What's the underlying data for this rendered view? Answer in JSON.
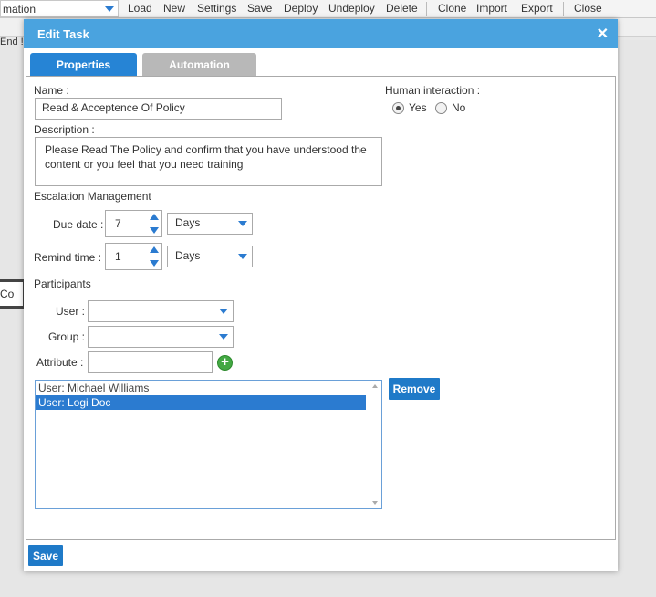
{
  "background": {
    "workflow_select": "mation",
    "menu": [
      "Load",
      "New",
      "Settings",
      "Save",
      "Deploy",
      "Undeploy",
      "Delete",
      "Clone",
      "Import",
      "Export",
      "Close"
    ],
    "end_label": "End !",
    "node_label": "Co"
  },
  "dialog": {
    "title": "Edit Task",
    "close_glyph": "✕",
    "tabs": {
      "properties": "Properties",
      "automation": "Automation"
    },
    "name_label": "Name :",
    "name_value": "Read & Acceptence Of Policy",
    "description_label": "Description :",
    "description_value": "Please Read The Policy and confirm that you have understood the content or you feel that you need training",
    "human_interaction_label": "Human interaction :",
    "human_interaction": {
      "yes": "Yes",
      "no": "No",
      "selected": "Yes"
    },
    "escalation_label": "Escalation Management",
    "due_date": {
      "label": "Due date :",
      "value": "7",
      "unit": "Days"
    },
    "remind_time": {
      "label": "Remind time :",
      "value": "1",
      "unit": "Days"
    },
    "participants_label": "Participants",
    "user_label": "User :",
    "group_label": "Group :",
    "attribute_label": "Attribute :",
    "add_glyph": "+",
    "participants_list": [
      "User: Michael Williams",
      "User: Logi Doc"
    ],
    "selected_participant": "User: Logi Doc",
    "remove_button": "Remove",
    "save_button": "Save"
  },
  "colors": {
    "header": "#4aa3df",
    "accent": "#2684d5",
    "tab_inactive": "#b8b8b8",
    "add": "#43a843"
  }
}
